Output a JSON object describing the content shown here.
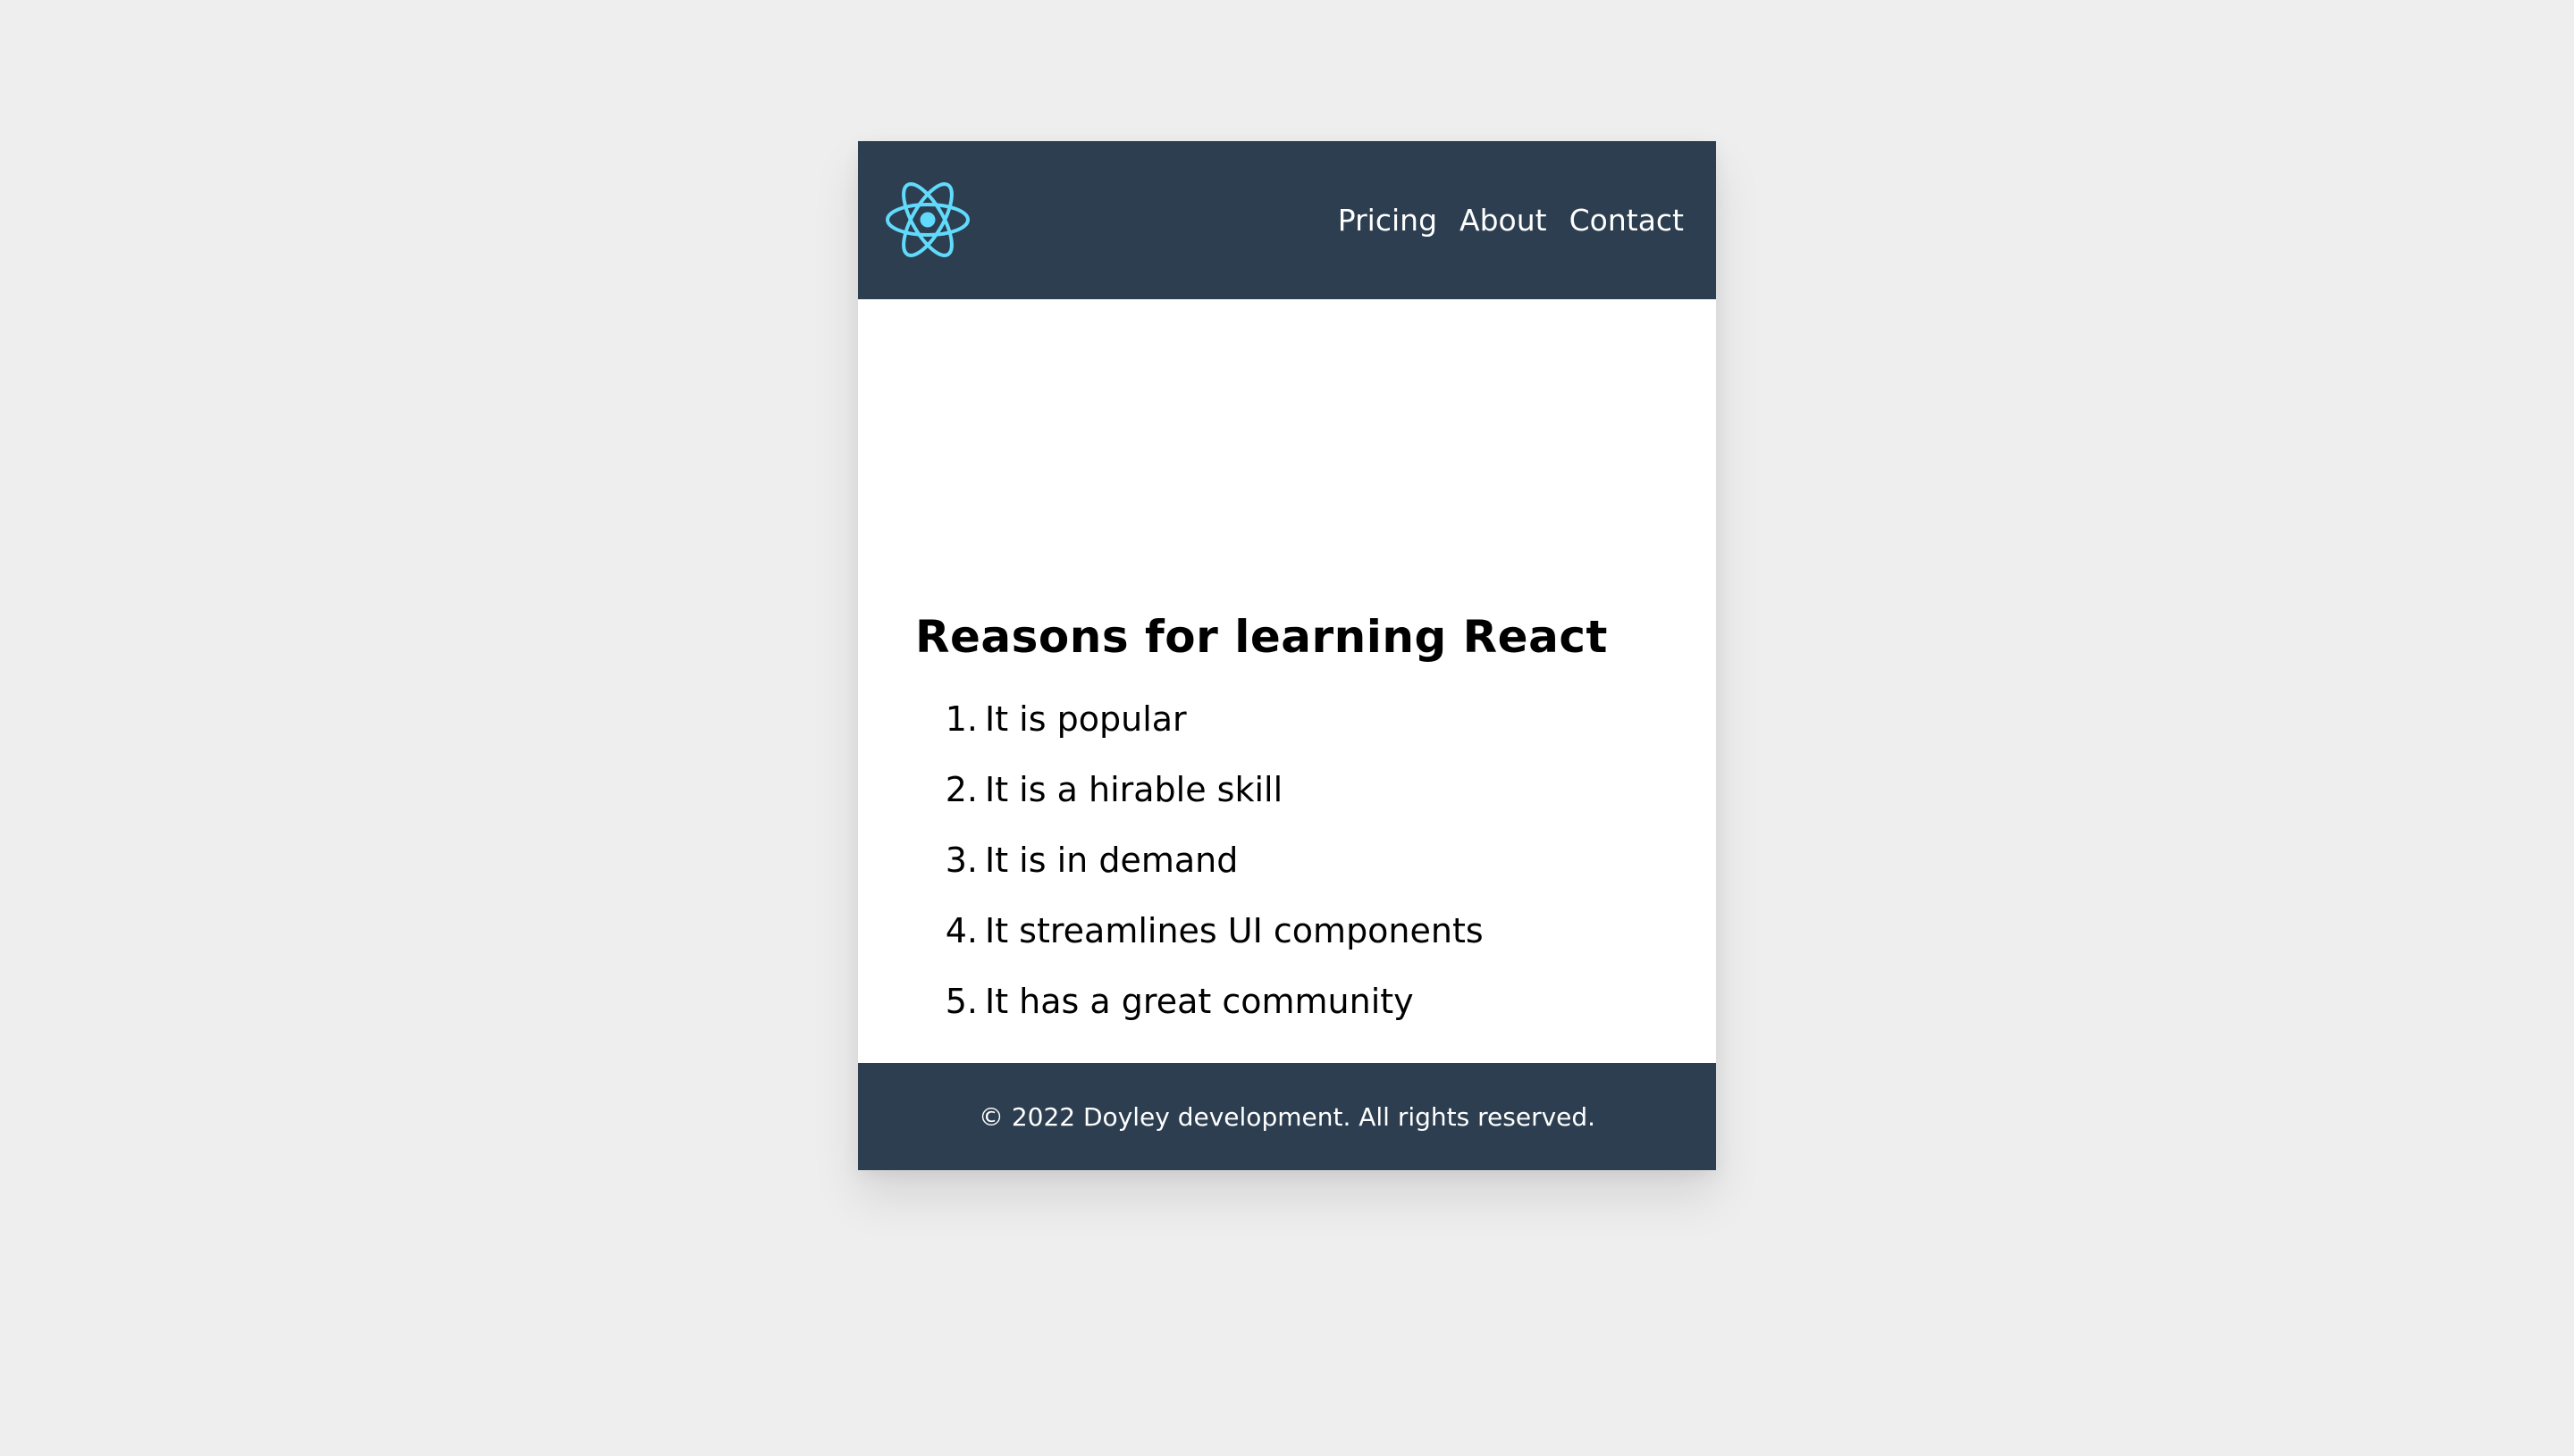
{
  "header": {
    "logo_icon": "react-atom-icon",
    "logo_color": "#61dafb",
    "background_color": "#2c3e50",
    "nav": [
      {
        "label": "Pricing"
      },
      {
        "label": "About"
      },
      {
        "label": "Contact"
      }
    ]
  },
  "main": {
    "title": "Reasons for learning React",
    "items": [
      {
        "number": "1.",
        "text": "It is popular"
      },
      {
        "number": "2.",
        "text": "It is a hirable skill"
      },
      {
        "number": "3.",
        "text": "It is in demand"
      },
      {
        "number": "4.",
        "text": "It streamlines UI components"
      },
      {
        "number": "5.",
        "text": "It has a great community"
      }
    ]
  },
  "footer": {
    "text": "© 2022 Doyley development. All rights reserved."
  }
}
